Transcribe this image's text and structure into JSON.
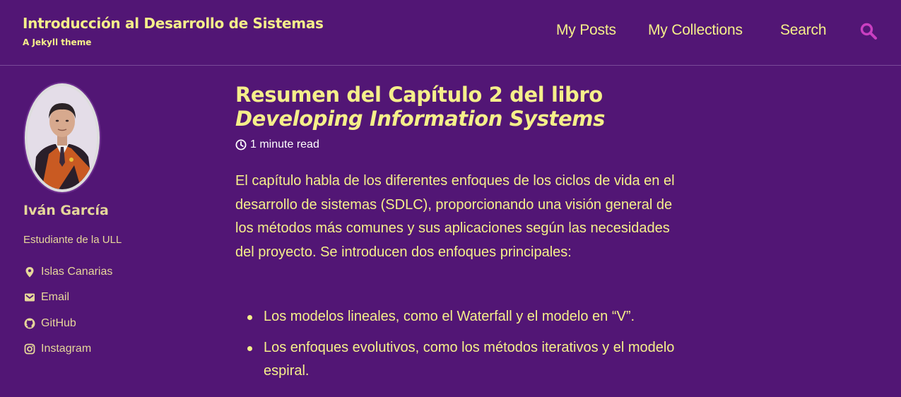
{
  "site": {
    "title": "Introducción al Desarrollo de Sistemas",
    "subtitle": "A Jekyll theme"
  },
  "nav": {
    "items": [
      {
        "label": "My Posts"
      },
      {
        "label": "My Collections"
      },
      {
        "label": "Search"
      }
    ],
    "search_icon": "magnifier-icon"
  },
  "author": {
    "name": "Iván García",
    "bio": "Estudiante de la ULL",
    "links": [
      {
        "label": "Islas Canarias",
        "icon": "map-marker-icon"
      },
      {
        "label": "Email",
        "icon": "envelope-icon"
      },
      {
        "label": "GitHub",
        "icon": "github-icon"
      },
      {
        "label": "Instagram",
        "icon": "instagram-icon"
      }
    ]
  },
  "post": {
    "title_line1": "Resumen del Capítulo 2 del libro",
    "title_line2": "Developing Information Systems",
    "read_time": "1 minute read",
    "intro": "El capítulo habla de los diferentes enfoques de los ciclos de vida en el desarrollo de sistemas (SDLC), proporcionando una visión general de los métodos más comunes y sus aplicaciones según las necesidades del proyecto. Se introducen dos enfoques principales:",
    "bullets": [
      "Los modelos lineales, como el Waterfall y el modelo en “V”.",
      "Los enfoques evolutivos, como los métodos iterativos y el modelo espiral."
    ]
  },
  "colors": {
    "background": "#521675",
    "title": "#f5ef8a",
    "sidebar_text": "#e6d79a",
    "search_icon": "#c93fc1"
  }
}
